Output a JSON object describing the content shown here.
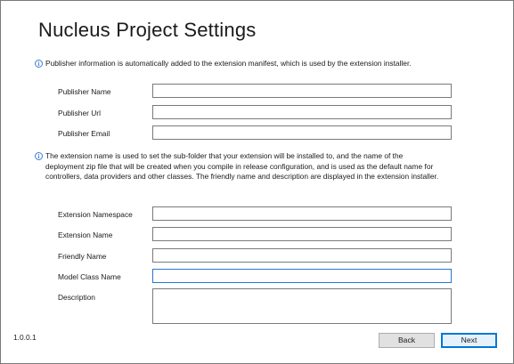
{
  "window": {
    "title": "Nucleus Project Settings"
  },
  "publisher_section": {
    "info_icon": "info-icon",
    "info_text": "Publisher information is automatically added to the extension manifest, which is used by the extension installer.",
    "fields": [
      {
        "label": "Publisher Name",
        "value": "",
        "placeholder": ""
      },
      {
        "label": "Publisher Url",
        "value": "",
        "placeholder": ""
      },
      {
        "label": "Publisher Email",
        "value": "",
        "placeholder": ""
      }
    ]
  },
  "extension_section": {
    "info_icon": "info-icon",
    "info_text": "The extension name is used to set the sub-folder that your extension will be installed to, and the name of the deployment zip file that will be created when you compile in release configuration, and is used as the default name for controllers, data providers and other classes.  The friendly name and description are displayed in the extension installer.",
    "fields": [
      {
        "label": "Extension Namespace",
        "value": "",
        "placeholder": ""
      },
      {
        "label": "Extension Name",
        "value": "",
        "placeholder": ""
      },
      {
        "label": "Friendly Name",
        "value": "",
        "placeholder": ""
      },
      {
        "label": "Model Class Name",
        "value": "",
        "placeholder": "",
        "focused": true
      },
      {
        "label": "Description",
        "value": "",
        "placeholder": ""
      }
    ]
  },
  "footer": {
    "version": "1.0.0.1",
    "back_label": "Back",
    "next_label": "Next"
  },
  "colors": {
    "accent": "#0078d7",
    "info_icon": "#3b7fd1",
    "focused_border": "#2b73d6"
  }
}
